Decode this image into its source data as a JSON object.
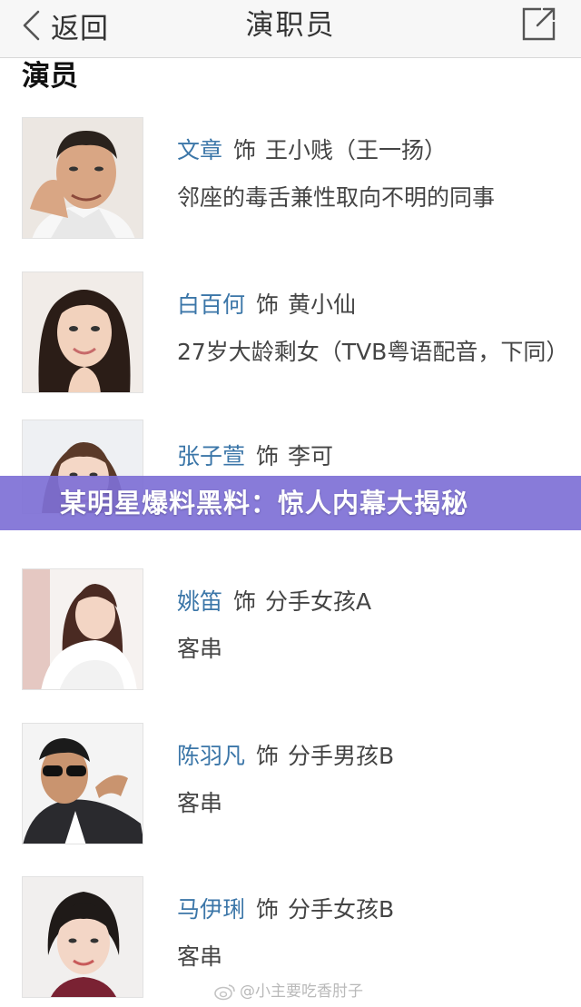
{
  "navbar": {
    "back_label": "返回",
    "title": "演职员"
  },
  "section": {
    "title": "演员"
  },
  "cast": [
    {
      "actor": "文章",
      "sep": "饰",
      "role": "王小贱（王一扬）",
      "desc": "邻座的毒舌兼性取向不明的同事"
    },
    {
      "actor": "白百何",
      "sep": "饰",
      "role": "黄小仙",
      "desc": "27岁大龄剩女（TVB粤语配音，下同）"
    },
    {
      "actor": "张子萱",
      "sep": "饰",
      "role": "李可",
      "desc": ""
    },
    {
      "actor": "姚笛",
      "sep": "饰",
      "role": "分手女孩A",
      "desc": "客串"
    },
    {
      "actor": "陈羽凡",
      "sep": "饰",
      "role": "分手男孩B",
      "desc": "客串"
    },
    {
      "actor": "马伊琍",
      "sep": "饰",
      "role": "分手女孩B",
      "desc": "客串"
    }
  ],
  "banner": {
    "text": "某明星爆料黑料：惊人内幕大揭秘"
  },
  "watermark": {
    "text": "@小主要吃香肘子"
  },
  "colors": {
    "actor_link": "#3b76a8",
    "banner": "#7e70d6",
    "navbar_bg": "#f7f7f7"
  }
}
